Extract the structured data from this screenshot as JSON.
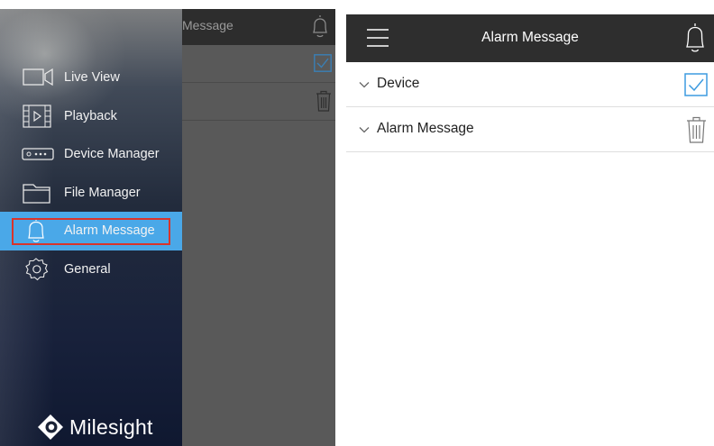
{
  "left": {
    "background_title": "Message",
    "menu": [
      {
        "label": "Live View",
        "icon": "live-view-icon"
      },
      {
        "label": "Playback",
        "icon": "playback-icon"
      },
      {
        "label": "Device Manager",
        "icon": "device-manager-icon"
      },
      {
        "label": "File Manager",
        "icon": "folder-icon"
      },
      {
        "label": "Alarm Message",
        "icon": "bell-icon",
        "active": true
      },
      {
        "label": "General",
        "icon": "gear-icon"
      }
    ],
    "brand": "Milesight"
  },
  "right": {
    "title": "Alarm Message",
    "rows": [
      {
        "label": "Device",
        "action_icon": "checkbox-icon"
      },
      {
        "label": "Alarm Message",
        "action_icon": "trash-icon"
      }
    ]
  },
  "colors": {
    "active_bg": "#4aa8e8",
    "highlight_outline": "#d9342b",
    "topbar": "#2e2e2e",
    "check_accent": "#3d9be0"
  }
}
